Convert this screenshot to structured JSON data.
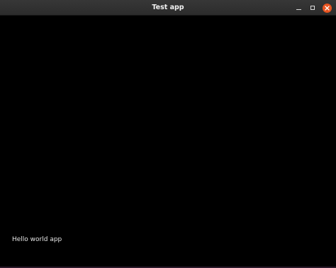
{
  "window": {
    "title": "Test app",
    "accent_close": "#e95420"
  },
  "controls": {
    "minimize_icon": "minimize-icon",
    "maximize_icon": "maximize-icon",
    "close_icon": "close-icon"
  },
  "content": {
    "label": "Hello world app"
  }
}
